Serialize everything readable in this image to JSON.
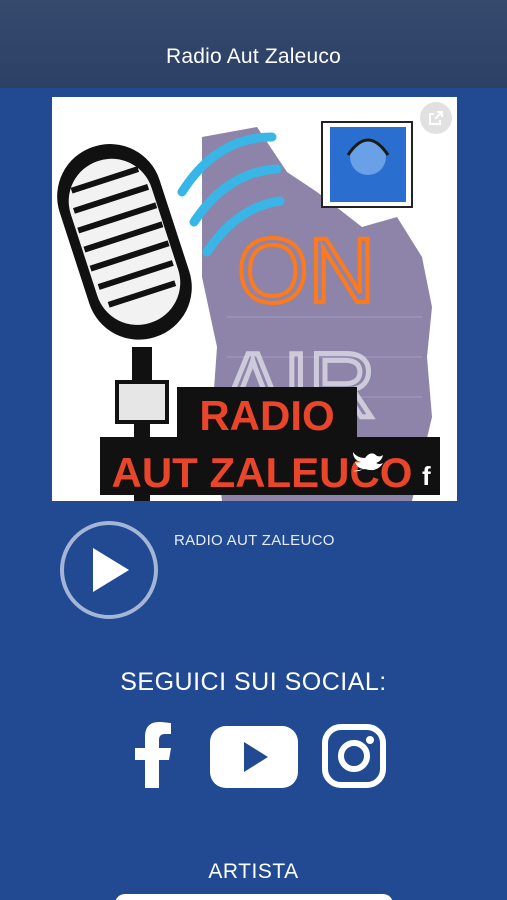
{
  "header": {
    "title": "Radio Aut Zaleuco"
  },
  "artwork": {
    "on_text": "ON",
    "air_text": "AIR",
    "banner_line1": "RADIO",
    "banner_line2": "AUT ZALEUCO",
    "fb_mark": "f"
  },
  "player": {
    "station_label": "RADIO AUT ZALEUCO"
  },
  "social": {
    "title": "SEGUICI SUI SOCIAL:",
    "icons": [
      "facebook-icon",
      "youtube-icon",
      "instagram-icon"
    ]
  },
  "artist": {
    "label": "ARTISTA"
  },
  "colors": {
    "background": "#214a93",
    "header": "#2f4469",
    "neon": "#ff7a1a",
    "banner_text": "#e8452a"
  }
}
